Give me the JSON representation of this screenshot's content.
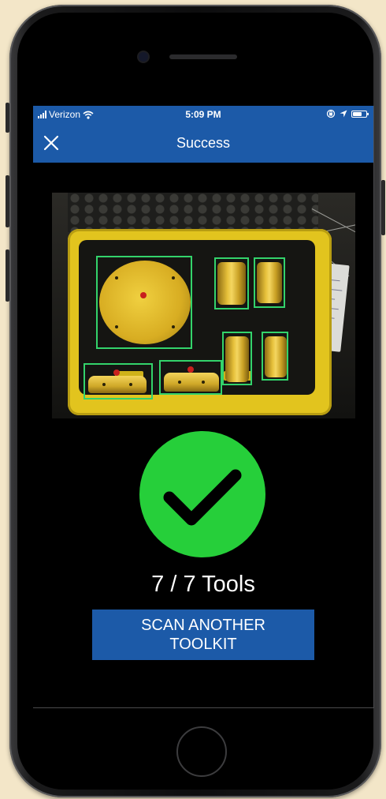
{
  "status_bar": {
    "carrier": "Verizon",
    "time": "5:09 PM",
    "battery_level": 0.7,
    "icons": [
      "signal-bars-icon",
      "wifi-icon",
      "orientation-lock-icon",
      "location-arrow-icon",
      "battery-icon"
    ]
  },
  "nav": {
    "title": "Success",
    "close_icon": "close-icon"
  },
  "result": {
    "icon": "checkmark-icon",
    "detected_tools": 7,
    "total_tools": 7,
    "text": "7 / 7 Tools"
  },
  "scan_button": {
    "line1": "SCAN ANOTHER",
    "line2": "TOOLKIT"
  },
  "colors": {
    "accent": "#1c5aa8",
    "success": "#26cf3a",
    "detection_box": "#33d36b",
    "background": "#000000"
  }
}
